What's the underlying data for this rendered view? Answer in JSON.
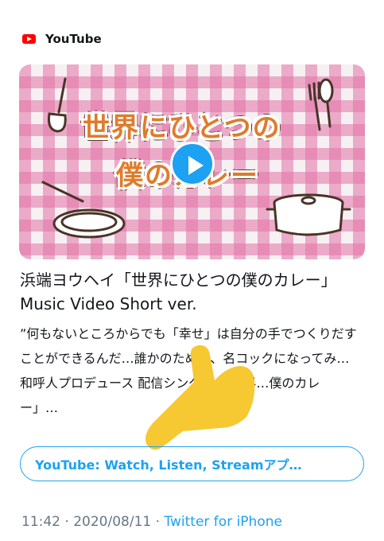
{
  "card": {
    "source": {
      "name": "YouTube",
      "icon": "youtube-icon",
      "icon_color": "#ff0000"
    },
    "thumbnail": {
      "title_line_1": "世界にひとつの",
      "title_line_2": "僕のカレー",
      "play_icon": "play-icon",
      "accent_color": "#1da1f2"
    },
    "title": "浜端ヨウヘイ「世界にひとつの僕のカレー」Music Video Short ver.",
    "description": "”何もないところからでも「幸せ」は自分の手でつくりだすことができるんだ…誰かのために、名コックになってみ…和呼人プロデュース 配信シングル 「世界…僕のカレー」…",
    "cta_label": "YouTube: Watch, Listen, Streamアプ…"
  },
  "meta": {
    "time": "11:42",
    "separator": "·",
    "date": "2020/08/11",
    "client": "Twitter for iPhone",
    "link_color": "#1da1f2",
    "muted_color": "#657786"
  }
}
